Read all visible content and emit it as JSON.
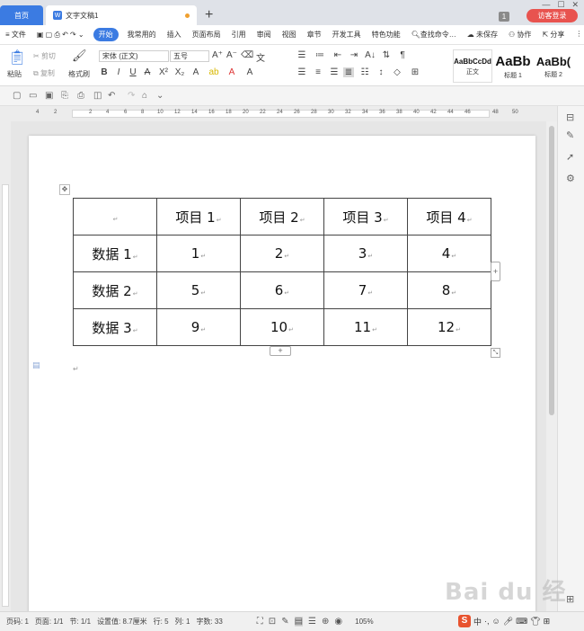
{
  "titlebar": {
    "home_tab": "首页",
    "doc_tab": "文字文稿1",
    "add_tab": "+",
    "badge": "1",
    "guest_login": "访客登录"
  },
  "menu": {
    "file": "≡ 文件",
    "items": [
      "开始",
      "我常用的",
      "插入",
      "页面布局",
      "引用",
      "审阅",
      "视图",
      "章节",
      "开发工具",
      "特色功能"
    ],
    "search": "查找命令…",
    "unsaved": "未保存",
    "collab": "协作",
    "share": "分享"
  },
  "ribbon": {
    "paste": "粘贴",
    "cut": "剪切",
    "copy": "复制",
    "format_painter": "格式刷",
    "font_name": "宋体 (正文)",
    "font_size": "五号",
    "styles": [
      {
        "preview": "AaBbCcDd",
        "label": "正文"
      },
      {
        "preview": "AaBb",
        "label": "标题 1"
      },
      {
        "preview": "AaBb(",
        "label": "标题 2"
      }
    ]
  },
  "ruler": {
    "numbers": [
      "4",
      "2",
      "2",
      "4",
      "6",
      "8",
      "10",
      "12",
      "14",
      "16",
      "18",
      "20",
      "22",
      "24",
      "26",
      "28",
      "30",
      "32",
      "34",
      "36",
      "38",
      "40",
      "42",
      "44",
      "46",
      "48",
      "50"
    ]
  },
  "table": {
    "header": [
      "",
      "项目 1",
      "项目 2",
      "项目 3",
      "项目 4"
    ],
    "rows": [
      [
        "数据 1",
        "1",
        "2",
        "3",
        "4"
      ],
      [
        "数据 2",
        "5",
        "6",
        "7",
        "8"
      ],
      [
        "数据 3",
        "9",
        "10",
        "11",
        "12"
      ]
    ]
  },
  "statusbar": {
    "page_num": "页码: 1",
    "pages": "页面: 1/1",
    "section": "节: 1/1",
    "position": "设置值: 8.7厘米",
    "line": "行: 5",
    "column": "列: 1",
    "word_count": "字数: 33",
    "zoom": "105%"
  },
  "watermark": "Bai du 经验",
  "colors": {
    "accent": "#3b7be2",
    "guest": "#e8534f"
  }
}
